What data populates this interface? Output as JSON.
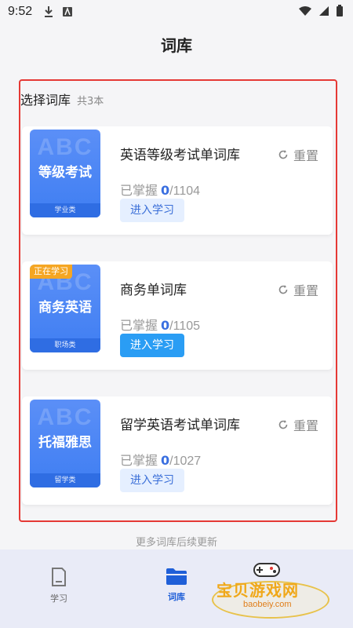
{
  "status_bar": {
    "time": "9:52"
  },
  "header": {
    "title": "词库"
  },
  "section": {
    "title": "选择词库",
    "count": "共3本"
  },
  "libraries": [
    {
      "cover_bg_text": "ABC",
      "cover_title": "等级考试",
      "cover_category": "学业类",
      "tag": "",
      "name": "英语等级考试单词库",
      "reset_label": "重置",
      "progress_label": "已掌握",
      "mastered": "0",
      "total": "/1104",
      "button_label": "进入学习"
    },
    {
      "cover_bg_text": "ABC",
      "cover_title": "商务英语",
      "cover_category": "职场类",
      "tag": "正在学习",
      "name": "商务单词库",
      "reset_label": "重置",
      "progress_label": "已掌握",
      "mastered": "0",
      "total": "/1105",
      "button_label": "进入学习"
    },
    {
      "cover_bg_text": "ABC",
      "cover_title": "托福雅思",
      "cover_category": "留学类",
      "tag": "",
      "name": "留学英语考试单词库",
      "reset_label": "重置",
      "progress_label": "已掌握",
      "mastered": "0",
      "total": "/1027",
      "button_label": "进入学习"
    }
  ],
  "footer_note": "更多词库后续更新",
  "nav": [
    {
      "label": "学习",
      "icon": "document-icon"
    },
    {
      "label": "词库",
      "icon": "folder-icon"
    }
  ],
  "watermark": {
    "text": "宝贝游戏网",
    "url": "baobeiy.com"
  },
  "colors": {
    "accent": "#3a6fe0",
    "active_button": "#2a9df4",
    "tag": "#f5a623",
    "frame": "#e53935"
  }
}
